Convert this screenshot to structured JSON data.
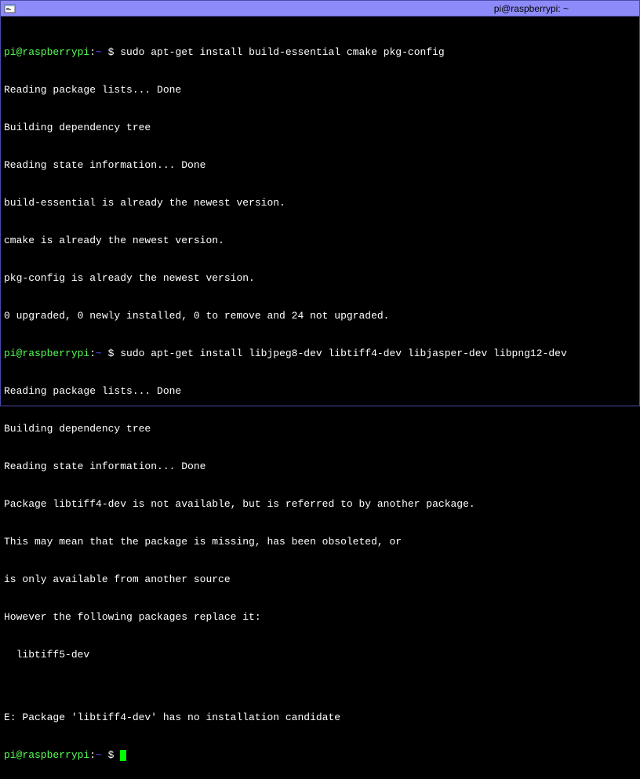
{
  "window": {
    "title": "pi@raspberrypi: ~"
  },
  "prompt": {
    "userhost": "pi@raspberrypi",
    "sep1": ":",
    "path": "~",
    "sym": " $ "
  },
  "cmd1": "sudo apt-get install build-essential cmake pkg-config",
  "out1": [
    "Reading package lists... Done",
    "Building dependency tree",
    "Reading state information... Done",
    "build-essential is already the newest version.",
    "cmake is already the newest version.",
    "pkg-config is already the newest version.",
    "0 upgraded, 0 newly installed, 0 to remove and 24 not upgraded."
  ],
  "cmd2": "sudo apt-get install libjpeg8-dev libtiff4-dev libjasper-dev libpng12-dev",
  "out2": [
    "Reading package lists... Done",
    "Building dependency tree",
    "Reading state information... Done",
    "Package libtiff4-dev is not available, but is referred to by another package.",
    "This may mean that the package is missing, has been obsoleted, or",
    "is only available from another source",
    "However the following packages replace it:",
    "  libtiff5-dev",
    "",
    "E: Package 'libtiff4-dev' has no installation candidate"
  ]
}
